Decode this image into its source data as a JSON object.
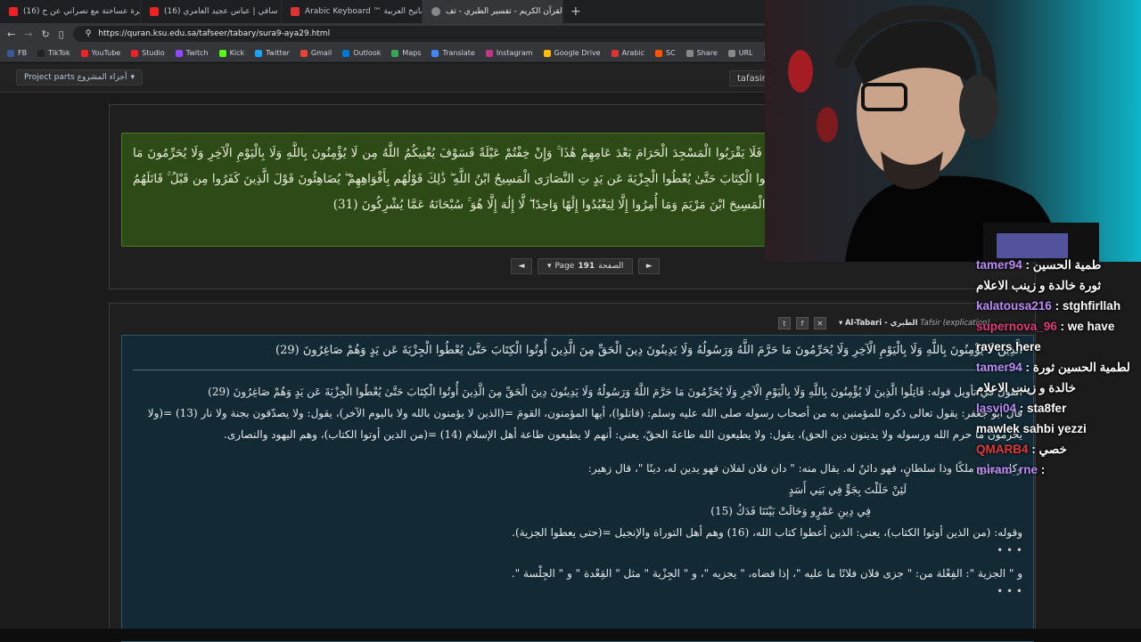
{
  "tabs": [
    {
      "title": "(16) مناظرة عساخنة مع نصراني عن ح",
      "color": "#e22"
    },
    {
      "title": "(16) احمل سافي | عباس عجيد العامري",
      "color": "#e22"
    },
    {
      "title": "Arabic Keyboard ™ لوحة المفاتيح العربية",
      "color": "#d33"
    },
    {
      "title": "القرآن الكريم - تفسير الطبري - تف",
      "color": "#888",
      "active": true
    }
  ],
  "address": {
    "url": "https://quran.ksu.edu.sa/tafseer/tabary/sura9-aya29.html"
  },
  "bookmarks": [
    {
      "label": "FB",
      "color": "#3b5998"
    },
    {
      "label": "TikTok",
      "color": "#222"
    },
    {
      "label": "YouTube",
      "color": "#e22"
    },
    {
      "label": "Studio",
      "color": "#e22"
    },
    {
      "label": "Twitch",
      "color": "#9146ff"
    },
    {
      "label": "Kick",
      "color": "#53fc18"
    },
    {
      "label": "Twitter",
      "color": "#1da1f2"
    },
    {
      "label": "Gmail",
      "color": "#ea4335"
    },
    {
      "label": "Outlook",
      "color": "#0078d4"
    },
    {
      "label": "Maps",
      "color": "#34a853"
    },
    {
      "label": "Translate",
      "color": "#4285f4"
    },
    {
      "label": "Instagram",
      "color": "#c13584"
    },
    {
      "label": "Google Drive",
      "color": "#fbbc04"
    },
    {
      "label": "Arabic",
      "color": "#d33"
    },
    {
      "label": "SC",
      "color": "#f50"
    },
    {
      "label": "Share",
      "color": "#888"
    },
    {
      "label": "URL",
      "color": "#888"
    },
    {
      "label": "TN",
      "color": "#555"
    },
    {
      "label": "Ch",
      "color": "#555"
    }
  ],
  "project": {
    "button": "Project parts أجزاء المشروع",
    "tafasir": "tafasir"
  },
  "ayah_text": "رَّجِيمٌ (27) يَا أَيُّهَا الَّذِينَ آمَنُوا إِنَّمَا الْمُشْرِكُونَ نَجَسٌ فَلَا يَقْرَبُوا الْمَسْجِدَ الْحَرَامَ بَعْدَ عَامِهِمْ هَٰذَا ۚ وَإِنْ خِفْتُمْ عَيْلَةً فَسَوْفَ يُغْنِيكُمُ اللَّهُ مِن لَا يُؤْمِنُونَ بِاللَّهِ وَلَا بِالْيَوْمِ الْآخِرِ وَلَا يُحَرِّمُونَ مَا حَرَّمَ اللَّهُ وَرَسُولُهُ وَلَا يَدِينُونَ دِينَ الْحَقِّ مِنَ الَّذِينَ أُوتُوا الْكِتَابَ حَتَّىٰ يُعْطُوا الْجِزْيَةَ عَن يَدٍ تِ النَّصَارَى الْمَسِيحُ ابْنُ اللَّهِ ۖ ذَٰلِكَ قَوْلُهُم بِأَفْوَاهِهِمْ ۖ يُضَاهِئُونَ قَوْلَ الَّذِينَ كَفَرُوا مِن قَبْلُ ۚ قَاتَلَهُمُ اللَّهُ ۚ أَنَّىٰ يُؤْفَكُونَ (30) اتَّخَذُوا أَحْبَارَهُمْ ن دُونِ اللَّهِ وَالْمَسِيحَ ابْنَ مَرْيَمَ وَمَا أُمِرُوا إِلَّا لِيَعْبُدُوا إِلَٰهًا وَاحِدًا ۖ لَّا إِلَٰهَ إِلَّا هُوَ ۚ سُبْحَانَهُ عَمَّا يُشْرِكُونَ (31)",
  "pager": {
    "prev": "◄",
    "next": "►",
    "label": "Page",
    "number": "191",
    "arabic": "الصفحة"
  },
  "tafsir_bar": {
    "title": "Al-Tabari - الطبري",
    "subtitle": "Tafsir (explication)"
  },
  "tafsir_head": "الَّذِينَ لَا يُؤْمِنُونَ بِاللَّهِ وَلَا بِالْيَوْمِ الْآخِرِ وَلَا يُحَرِّمُونَ مَا حَرَّمَ اللَّهُ وَرَسُولُهُ وَلَا يَدِينُونَ دِينَ الْحَقِّ مِنَ الَّذِينَ أُوتُوا الْكِتَابَ حَتَّىٰ يُعْطُوا الْجِزْيَةَ عَن يَدٍ وَهُمْ صَاغِرُونَ (29)",
  "tafsir_lines": [
    "القول في تأويل قوله: قَاتِلُوا الَّذِينَ لَا يُؤْمِنُونَ بِاللَّهِ وَلَا بِالْيَوْمِ الْآخِرِ وَلَا يُحَرِّمُونَ مَا حَرَّمَ اللَّهُ وَرَسُولُهُ وَلَا يَدِينُونَ دِينَ الْحَقِّ مِنَ الَّذِينَ أُوتُوا الْكِتَابَ حَتَّىٰ يُعْطُوا الْجِزْيَةَ عَن يَدٍ وَهُمْ صَاغِرُونَ (29)",
    "قال أبو جعفر: يقول تعالى ذكره للمؤمنين به من أصحاب رسوله صلى الله عليه وسلم: (قاتلوا)، أيها المؤمنون، القومَ =(الذين لا يؤمنون بالله ولا باليوم الآخر)، يقول: ولا يصدّقون بجنة ولا نار (13) =(ولا يحرمون ما حرم الله ورسوله ولا يدينون دين الحق)، يقول: ولا يطيعون الله طاعةَ الحقّ، يعني: أنهم لا يطيعون طاعة أهل الإسلام (14) =(من الذين أوتوا الكتاب)، وهم اليهود والنصارى.",
    "وكل مطيع ملكًا وذا سلطانٍ، فهو دائنٌ له. يقال منه: \" دان فلان لفلان فهو يدين له، دينًا \"، قال زهير:",
    "لَئِنْ حَلَلْتَ بِجَوٍّ فِي بَنِي أَسَدٍ",
    "فِي دِينِ عَمْرٍو وَحَالَتْ بَيْنَنَا فَدَكُ (15)",
    "وقوله: (من الذين أوتوا الكتاب)، يعني: الذين أعطوا كتاب الله، (16) وهم أهل التوراة والإنجيل =(حتى يعطوا الجزية).",
    "و \" الجزية \": الفِعْلة من: \" جزى فلان فلانًا ما عليه \"، إذا قضاه، \" يجزيه \"، و \" الجِزْية \" مثل \" القِعْدة \" و \" الجِلْسة \"."
  ],
  "chat": [
    {
      "user": "tamer94",
      "msg": "طمية الحسين",
      "color": "#b98cf7"
    },
    {
      "user": "",
      "msg": "ثورة خالدة و زينب الاعلام",
      "color": "#fff"
    },
    {
      "user": "kalatousa216",
      "msg": "stghfirllah",
      "color": "#b98cf7"
    },
    {
      "user": "supernova_96",
      "msg": "we have",
      "color": "#e23b7a"
    },
    {
      "user": "",
      "msg": "rayers here",
      "color": "#fff"
    },
    {
      "user": "tamer94",
      "msg": "لطمية الحسين ثورة",
      "color": "#b98cf7"
    },
    {
      "user": "",
      "msg": "خالدة و زينب الاعلام",
      "color": "#fff"
    },
    {
      "user": "lasvi04",
      "msg": "sta8fer",
      "color": "#b98cf7"
    },
    {
      "user": "",
      "msg": "mawlek sahbi yezzi",
      "color": "#fff"
    },
    {
      "user": "QMARB4",
      "msg": "خصي",
      "color": "#e23b3b"
    },
    {
      "user": "miram_rne",
      "msg": "",
      "color": "#b98cf7"
    }
  ]
}
